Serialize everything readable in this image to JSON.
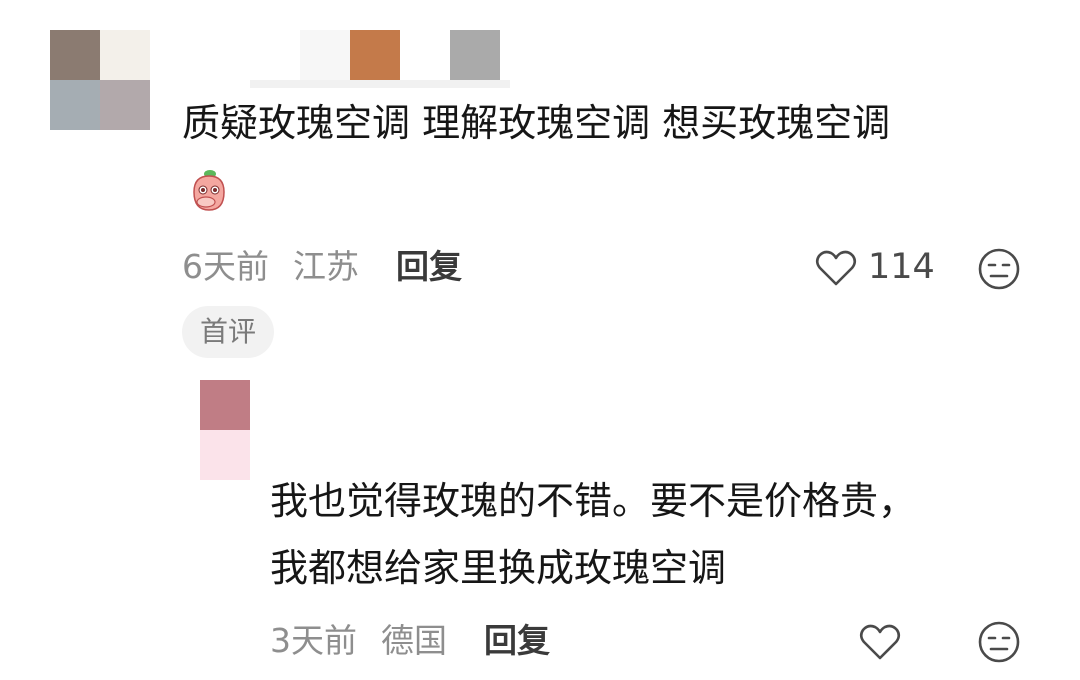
{
  "comment": {
    "text": "质疑玫瑰空调 理解玫瑰空调 想买玫瑰空调",
    "emoji_icon": "peach-cover-mouth-emoji",
    "time": "6天前",
    "location": "江苏",
    "reply_label": "回复",
    "like_count": "114",
    "badge": "首评"
  },
  "reply": {
    "line1": "我也觉得玫瑰的不错。要不是价格贵，",
    "line2": "我都想给家里换成玫瑰空调",
    "time": "3天前",
    "location": "德国",
    "reply_label": "回复"
  },
  "icons": {
    "like": "heart-outline-icon",
    "dislike": "meh-face-icon"
  },
  "colors": {
    "text": "#161616",
    "meta": "#8e8e8e",
    "tag_bg": "#f2f2f2"
  }
}
